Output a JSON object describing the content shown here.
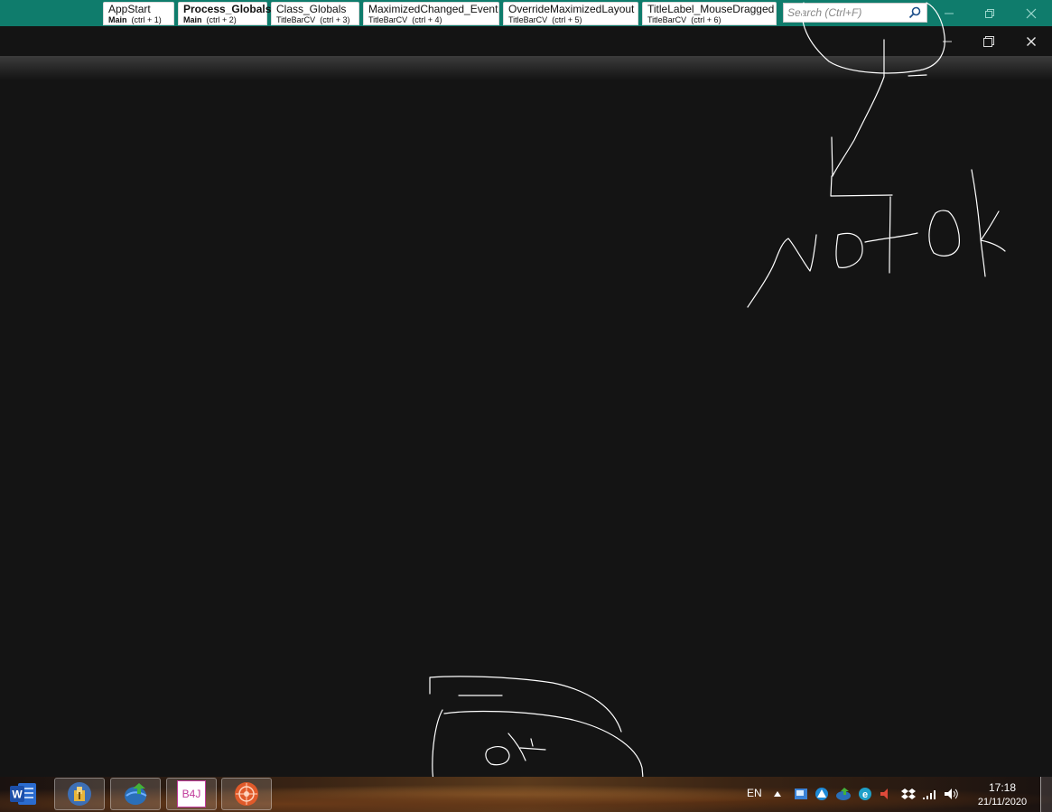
{
  "ide": {
    "tabs": [
      {
        "name": "AppStart",
        "module": "Main",
        "shortcut": "(ctrl + 1)",
        "active": false
      },
      {
        "name": "Process_Globals",
        "module": "Main",
        "shortcut": "(ctrl + 2)",
        "active": true
      },
      {
        "name": "Class_Globals",
        "module": "TitleBarCV",
        "shortcut": "(ctrl + 3)",
        "active": false
      },
      {
        "name": "MaximizedChanged_Event",
        "module": "TitleBarCV",
        "shortcut": "(ctrl + 4)",
        "active": false
      },
      {
        "name": "OverrideMaximizedLayout",
        "module": "TitleBarCV",
        "shortcut": "(ctrl + 5)",
        "active": false
      },
      {
        "name": "TitleLabel_MouseDragged",
        "module": "TitleBarCV",
        "shortcut": "(ctrl + 6)",
        "active": false
      }
    ],
    "search_placeholder": "Search (Ctrl+F)",
    "title_bar_color": "#0f7c6c"
  },
  "annotations": {
    "top_right": "not ok",
    "bottom": "ok"
  },
  "taskbar": {
    "apps": [
      "word-icon",
      "installer-icon",
      "download-manager-icon",
      "b4j-icon",
      "target-app-icon"
    ],
    "b4j_label": "B4J",
    "language": "EN",
    "time": "17:18",
    "date": "21/11/2020"
  }
}
